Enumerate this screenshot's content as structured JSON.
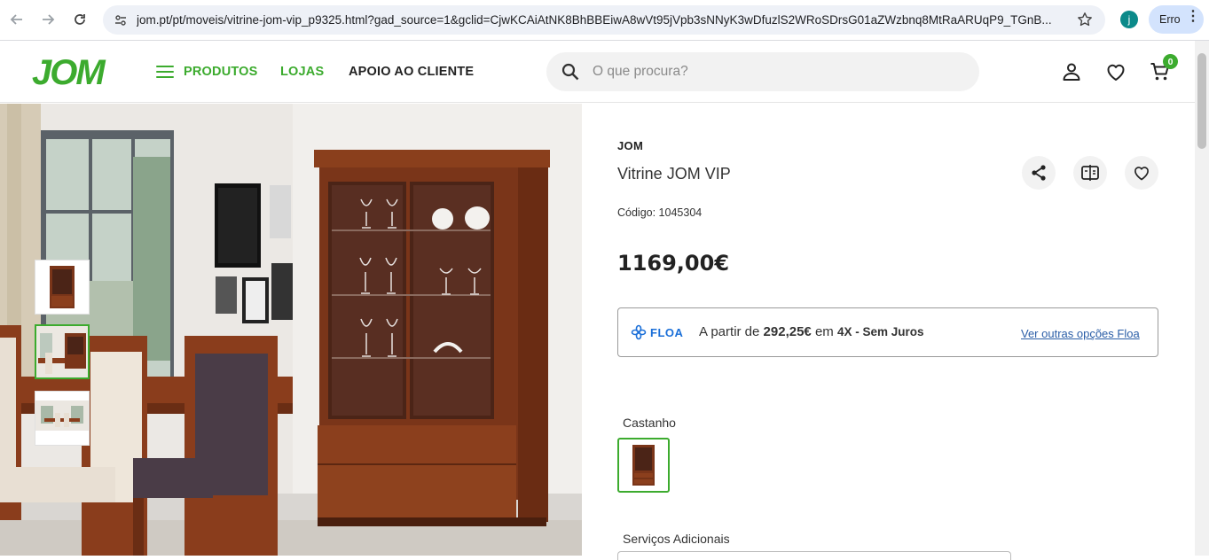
{
  "browser": {
    "url": "jom.pt/pt/moveis/vitrine-jom-vip_p9325.html?gad_source=1&gclid=CjwKCAiAtNK8BhBBEiwA8wVt95jVpb3sNNyK3wDfuzlS2WRoSDrsG01aZWzbnq8MtRaARUqP9_TGnB...",
    "profile_initial": "j",
    "error_label": "Erro"
  },
  "header": {
    "logo": "JOM",
    "nav": {
      "products": "PRODUTOS",
      "stores": "LOJAS",
      "support": "APOIO AO CLIENTE"
    },
    "search_placeholder": "O que procura?",
    "cart_count": "0"
  },
  "product": {
    "brand": "JOM",
    "title": "Vitrine JOM VIP",
    "code": "Código: 1045304",
    "price": "1169,00€",
    "floa": {
      "logo": "FLOA",
      "prefix": "A partir de ",
      "amount": "292,25€",
      "middle": " em ",
      "installments": "4X - Sem Juros",
      "link": "Ver outras opções Floa"
    },
    "color_label": "Castanho",
    "services_label": "Serviços Adicionais"
  },
  "colors": {
    "brand_green": "#3cab2e",
    "floa_blue": "#1b6fd8",
    "wood": "#7a3b1e"
  }
}
